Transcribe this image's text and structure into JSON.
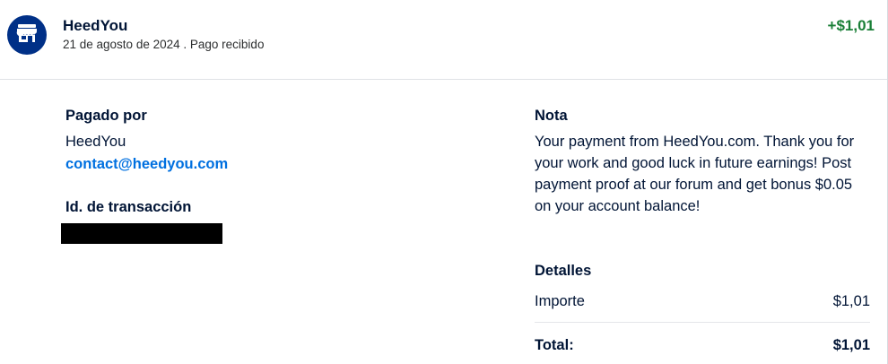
{
  "header": {
    "merchant_name": "HeedYou",
    "date": "21 de agosto de 2024",
    "separator": " . ",
    "status": "Pago recibido",
    "amount": "+$1,01",
    "avatar_icon": "store-icon",
    "avatar_color": "#003087",
    "amount_color": "#1a7f37"
  },
  "paid_by": {
    "title": "Pagado por",
    "name": "HeedYou",
    "email": "contact@heedyou.com"
  },
  "transaction": {
    "title": "Id. de transacción"
  },
  "note": {
    "title": "Nota",
    "text": "Your payment from HeedYou.com. Thank you for your work and good luck in future earnings! Post payment proof at our forum and get bonus $0.05 on your account balance!"
  },
  "details": {
    "title": "Detalles",
    "amount_label": "Importe",
    "amount_value": "$1,01",
    "total_label": "Total:",
    "total_value": "$1,01"
  }
}
